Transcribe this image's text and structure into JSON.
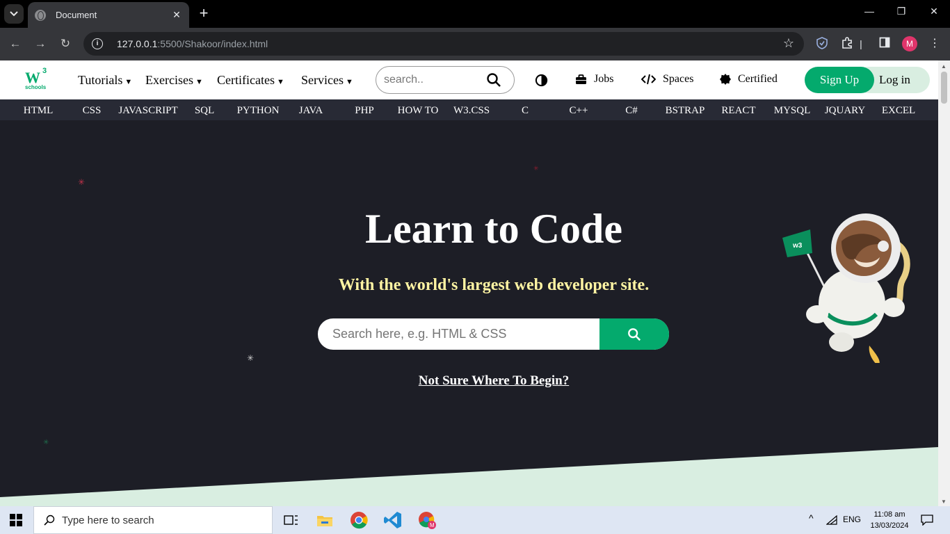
{
  "browser": {
    "tab_title": "Document",
    "url_host": "127.0.0.1",
    "url_rest": ":5500/Shakoor/index.html",
    "profile_initial": "M"
  },
  "topnav": {
    "logo_w": "W",
    "logo_sup": "3",
    "logo_sub": "schools",
    "menus": [
      "Tutorials",
      "Exercises",
      "Certificates",
      "Services"
    ],
    "search_placeholder": "search..",
    "jobs": "Jobs",
    "spaces": "Spaces",
    "certified": "Certified",
    "signup": "Sign Up",
    "login": "Log in"
  },
  "subnav": [
    "HTML",
    "CSS",
    "JAVASCRIPT",
    "SQL",
    "PYTHON",
    "JAVA",
    "PHP",
    "HOW TO",
    "W3.CSS",
    "C",
    "C++",
    "C#",
    "BSTRAP",
    "REACT",
    "MYSQL",
    "JQUARY",
    "EXCEL"
  ],
  "hero": {
    "title": "Learn to Code",
    "subtitle": "With the world's largest web developer site.",
    "search_placeholder": "Search here, e.g. HTML & CSS",
    "begin_link": "Not Sure Where To Begin?"
  },
  "colors": {
    "brand_green": "#04aa6d",
    "hero_bg": "#1d1e26",
    "subtitle_yellow": "#fff4a3",
    "subnav_bg": "#282a35",
    "mint": "#d9eee1"
  },
  "taskbar": {
    "search_placeholder": "Type here to search",
    "lang": "ENG",
    "time": "11:08 am",
    "date": "13/03/2024"
  }
}
